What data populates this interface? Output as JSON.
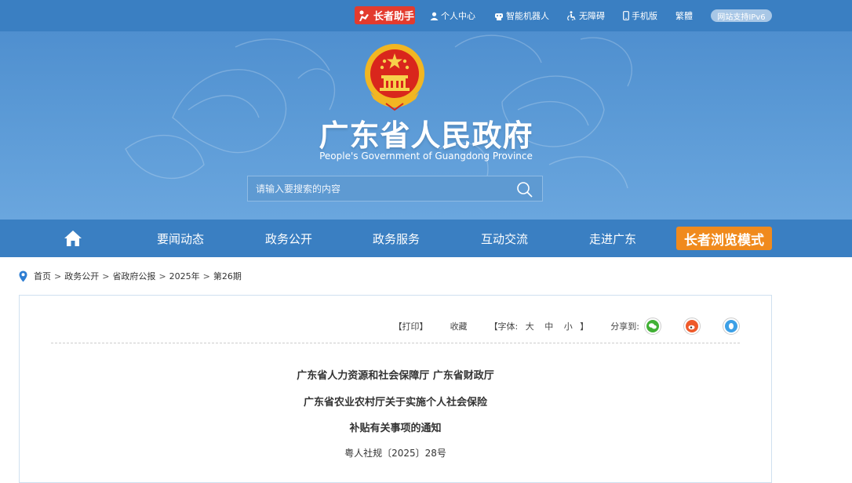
{
  "topbar": {
    "elder_label": "长者助手",
    "links": [
      {
        "icon": "person-icon",
        "label": "个人中心"
      },
      {
        "icon": "robot-icon",
        "label": "智能机器人"
      },
      {
        "icon": "accessibility-icon",
        "label": "无障碍"
      },
      {
        "icon": "mobile-icon",
        "label": "手机版"
      },
      {
        "icon": "",
        "label": "繁體"
      }
    ],
    "ipv6_label": "网站支持IPv6"
  },
  "header": {
    "title": "广东省人民政府",
    "subtitle": "People's Government of Guangdong Province",
    "search_placeholder": "请输入要搜索的内容"
  },
  "nav": {
    "items": [
      "要闻动态",
      "政务公开",
      "政务服务",
      "互动交流",
      "走进广东"
    ],
    "elder_mode_label": "长者浏览模式"
  },
  "breadcrumb": [
    "首页",
    "政务公开",
    "省政府公报",
    "2025年",
    "第26期"
  ],
  "tools": {
    "print": "【打印】",
    "favorite": "收藏",
    "font_prefix": "【字体:",
    "font_sizes": [
      "大",
      "中",
      "小"
    ],
    "font_suffix": "】",
    "share_label": "分享到:"
  },
  "article": {
    "title_lines": [
      "广东省人力资源和社会保障厅 广东省财政厅",
      "广东省农业农村厅关于实施个人社会保险",
      "补贴有关事项的通知"
    ],
    "doc_number": "粤人社规〔2025〕28号"
  },
  "colors": {
    "primary_blue": "#3a7fc2",
    "elder_red": "#e33b2e",
    "elder_orange": "#f08a1d"
  }
}
